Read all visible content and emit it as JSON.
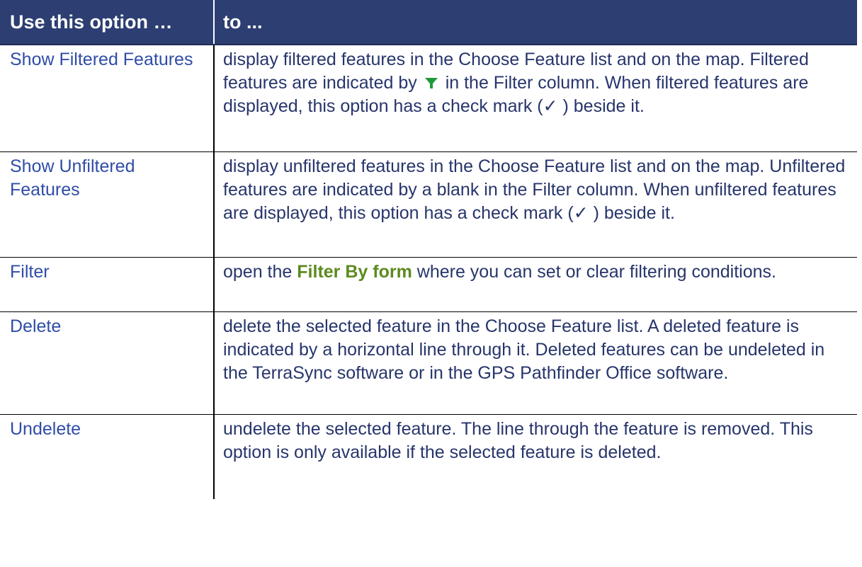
{
  "table": {
    "headers": [
      "Use this option …",
      "to ..."
    ],
    "rows": [
      {
        "option": "Show Filtered Features",
        "desc": {
          "p1": "display filtered features in the Choose Feature list and on the map. Filtered features are indicated by",
          "icon": "green-filter-funnel-icon",
          "p2": "in the Filter column. When filtered features are displayed, this option has a check mark (✓ ) beside it."
        }
      },
      {
        "option": "Show Unfiltered Features",
        "desc": "display unfiltered features in the Choose Feature list and on the map. Unfiltered features are indicated by a blank in the Filter column. When unfiltered features are displayed, this option has a check mark (✓ ) beside it."
      },
      {
        "option": "Filter",
        "desc": {
          "p1": "open the",
          "link": "Filter By form",
          "p2": "where you can set or clear filtering conditions."
        }
      },
      {
        "option": "Delete",
        "desc": "delete the selected feature in the Choose Feature list. A deleted feature is indicated by a horizontal line through it. Deleted features can be undeleted in the TerraSync software or in the GPS Pathfinder Office software."
      },
      {
        "option": "Undelete",
        "desc": "undelete the selected feature. The line through the feature is removed. This option is only available if the selected feature is deleted."
      }
    ]
  },
  "colors": {
    "header_bg": "#2c3e72",
    "header_text": "#ffffff",
    "body_text": "#27356b",
    "link": "#5d8a1f",
    "filter_icon": "#1f9a3a"
  }
}
